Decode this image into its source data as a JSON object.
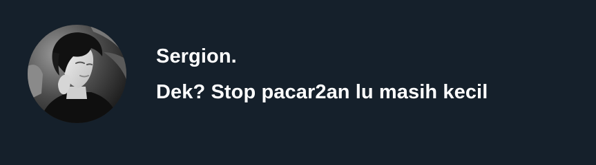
{
  "post": {
    "display_name": "Sergion.",
    "message": "Dek? Stop pacar2an lu masih kecil",
    "avatar_icon": "avatar-photo"
  },
  "colors": {
    "background": "#15202b",
    "text": "#ffffff"
  }
}
